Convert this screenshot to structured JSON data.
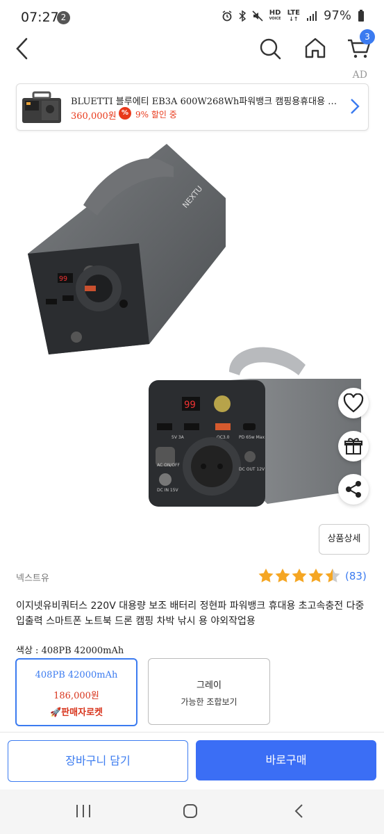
{
  "status_bar": {
    "time": "07:27",
    "notification_count": "2",
    "network_top": "HD",
    "network_bottom": "VOICE",
    "lte_top": "LTE",
    "battery": "97%"
  },
  "top_nav": {
    "back_icon": "chevron-left-icon",
    "search_icon": "search-icon",
    "home_icon": "home-icon",
    "cart_icon": "cart-icon",
    "cart_count": "3"
  },
  "ad": {
    "label": "AD",
    "title": "BLUETTI 블루에티 EB3A 600W268Wh파워뱅크 캠핑용휴대용 …",
    "price": "360,000원",
    "discount_icon": "%",
    "discount_text": "9% 할인 중",
    "colors": {
      "price": "#e8391b"
    }
  },
  "product": {
    "image_text": "NEXTU",
    "brand": "넥스트유",
    "rating": 4.5,
    "review_count": "(83)",
    "title": "이지넷유비쿼터스 220V 대용량 보조 배터리 정현파 파워뱅크 휴대용 초고속충전 다중 입출력 스마트폰 노트북 드론 캠핑 차박 낚시 용 야외작업용",
    "detail_button": "상품상세",
    "color_label": "색상 : 408PB 42000mAh",
    "device_display": "99",
    "ports": {
      "usb": "5V 3A",
      "qc": "QC3.0",
      "pd": "PD 65w Max",
      "acon": "AC ON/OFF",
      "dcout": "DC OUT 12V",
      "dcin": "DC IN 15V"
    }
  },
  "options": [
    {
      "name": "408PB 42000mAh",
      "price": "186,000원",
      "badge": "🚀판매자로켓",
      "selected": true
    },
    {
      "name": "그레이",
      "sub": "가능한 조합보기",
      "selected": false
    }
  ],
  "actions": {
    "cart": "장바구니 담기",
    "buy": "바로구매"
  },
  "colors": {
    "accent": "#3b7bf0",
    "buy": "#3b6ef5",
    "price_red": "#d8341c",
    "star": "#f5a623"
  }
}
